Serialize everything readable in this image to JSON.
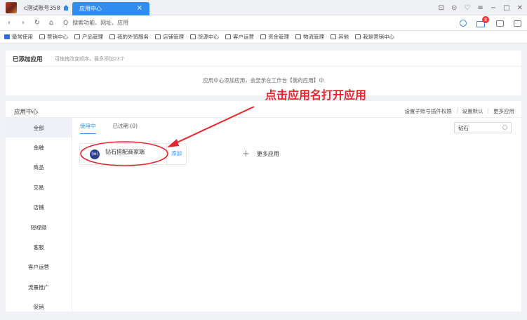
{
  "tabbar": {
    "account_name": "c测试账号358",
    "active_tab": "应用中心",
    "close_glyph": "×",
    "window_controls": [
      "⊡",
      "⊙",
      "♡",
      "≡",
      "−",
      "□",
      "✕"
    ]
  },
  "addrbar": {
    "back": "‹",
    "forward": "›",
    "refresh": "↻",
    "home": "⌂",
    "search_glyph": "Q",
    "placeholder": "搜索功能、网址、应用",
    "badge": "8"
  },
  "bookmarks": [
    "最常使用",
    "营销中心",
    "产品管理",
    "我的外贸服务",
    "店铺管理",
    "货源中心",
    "客户运营",
    "资金管理",
    "物流管理",
    "其他",
    "我是营销中心"
  ],
  "added_apps": {
    "title": "已添加应用",
    "subtitle": "可拖拽改变顺序，最多添加23个",
    "empty_text": "应用中心添加应用，会显示在工作台【我的应用】中"
  },
  "center": {
    "title": "应用中心",
    "links": [
      "设置子账号插件权限",
      "设置默认",
      "更多应用"
    ]
  },
  "sidebar": [
    "全部",
    "金融",
    "商品",
    "交易",
    "店铺",
    "短视频",
    "客服",
    "客户运营",
    "流量推广",
    "促销"
  ],
  "tabs": [
    "使用中",
    "已过期 (0)"
  ],
  "search": {
    "value": "钻石"
  },
  "app": {
    "logo_text": "(w)",
    "name": "钻石搭配商家端",
    "add_label": "添加"
  },
  "more_apps": {
    "plus": "+",
    "label": "更多应用"
  },
  "annotation": {
    "text": "点击应用名打开应用",
    "color": "#e8242c"
  },
  "colors": {
    "accent": "#2f8df0"
  }
}
